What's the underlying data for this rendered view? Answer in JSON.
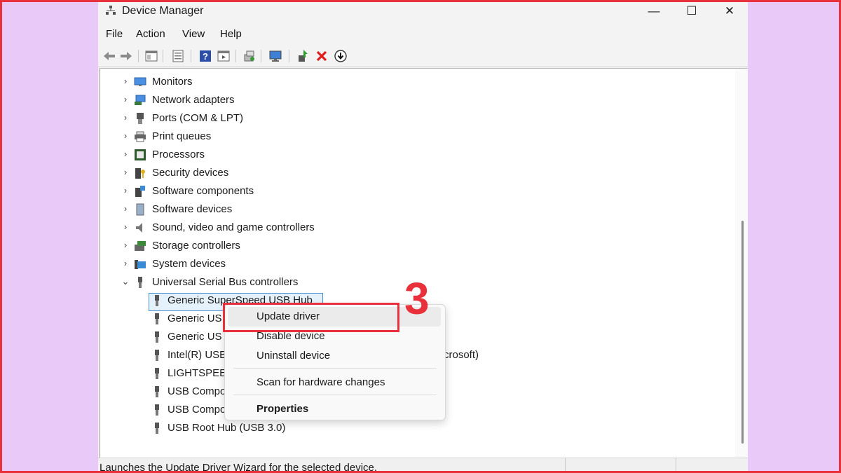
{
  "window": {
    "title": "Device Manager",
    "controls": {
      "minimize": "—",
      "maximize": "☐",
      "close": "✕"
    }
  },
  "menu": [
    "File",
    "Action",
    "View",
    "Help"
  ],
  "toolbar_icons": [
    "back-icon",
    "forward-icon",
    "show-hide-console-tree-icon",
    "properties-icon",
    "help-icon",
    "action-pane-icon",
    "scan-hardware-icon",
    "monitor-icon",
    "update-driver-icon",
    "uninstall-icon",
    "download-icon"
  ],
  "tree": {
    "categories": [
      {
        "label": "Monitors",
        "expanded": false,
        "icon": "monitor-icon"
      },
      {
        "label": "Network adapters",
        "expanded": false,
        "icon": "network-adapter-icon"
      },
      {
        "label": "Ports (COM & LPT)",
        "expanded": false,
        "icon": "port-icon"
      },
      {
        "label": "Print queues",
        "expanded": false,
        "icon": "printer-icon"
      },
      {
        "label": "Processors",
        "expanded": false,
        "icon": "processor-icon"
      },
      {
        "label": "Security devices",
        "expanded": false,
        "icon": "security-device-icon"
      },
      {
        "label": "Software components",
        "expanded": false,
        "icon": "software-component-icon"
      },
      {
        "label": "Software devices",
        "expanded": false,
        "icon": "software-device-icon"
      },
      {
        "label": "Sound, video and game controllers",
        "expanded": false,
        "icon": "speaker-icon"
      },
      {
        "label": "Storage controllers",
        "expanded": false,
        "icon": "storage-controller-icon"
      },
      {
        "label": "System devices",
        "expanded": false,
        "icon": "system-device-icon"
      },
      {
        "label": "Universal Serial Bus controllers",
        "expanded": true,
        "icon": "usb-icon"
      }
    ],
    "usb_children": [
      {
        "label": "Generic SuperSpeed USB Hub",
        "selected": true
      },
      {
        "label": "Generic US"
      },
      {
        "label": "Generic US"
      },
      {
        "label": "Intel(R) USB",
        "suffix": "crosoft)"
      },
      {
        "label": "LIGHTSPEE"
      },
      {
        "label": "USB Compo"
      },
      {
        "label": "USB Compo"
      },
      {
        "label": "USB Root Hub (USB 3.0)"
      }
    ]
  },
  "context_menu": {
    "items": [
      "Update driver",
      "Disable device",
      "Uninstall device",
      "Scan for hardware changes",
      "Properties"
    ],
    "highlighted": "Update driver"
  },
  "annotation": {
    "step": "3",
    "color": "#e8313a"
  },
  "status_bar": {
    "text": "Launches the Update Driver Wizard for the selected device."
  },
  "colors": {
    "background": "#e8c9f7",
    "accent_red": "#e8313a",
    "selection": "#e5f1fb"
  }
}
